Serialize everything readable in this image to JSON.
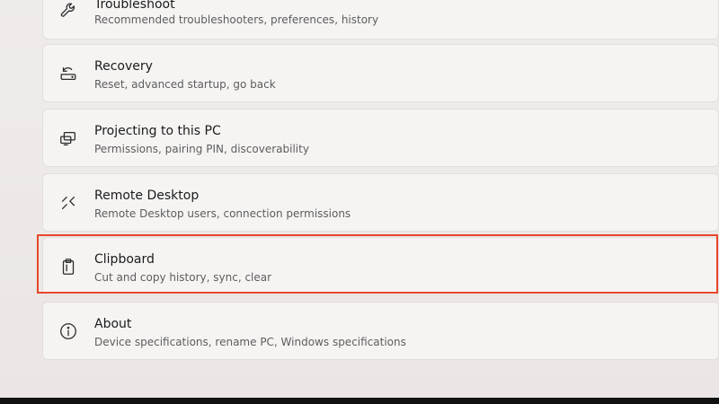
{
  "settings_items": [
    {
      "title": "Troubleshoot",
      "subtitle": "Recommended troubleshooters, preferences, history",
      "icon": "wrench-icon"
    },
    {
      "title": "Recovery",
      "subtitle": "Reset, advanced startup, go back",
      "icon": "recovery-icon"
    },
    {
      "title": "Projecting to this PC",
      "subtitle": "Permissions, pairing PIN, discoverability",
      "icon": "projecting-icon"
    },
    {
      "title": "Remote Desktop",
      "subtitle": "Remote Desktop users, connection permissions",
      "icon": "remote-desktop-icon"
    },
    {
      "title": "Clipboard",
      "subtitle": "Cut and copy history, sync, clear",
      "icon": "clipboard-icon",
      "highlighted": true
    },
    {
      "title": "About",
      "subtitle": "Device specifications, rename PC, Windows specifications",
      "icon": "info-icon"
    }
  ],
  "colors": {
    "highlight_border": "#e8462a",
    "card_background": "#f6f4f3",
    "page_background": "#ede8e6"
  }
}
